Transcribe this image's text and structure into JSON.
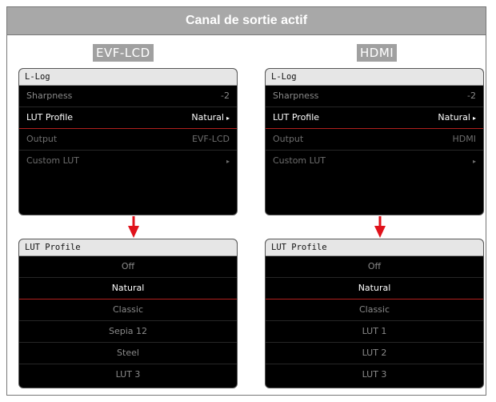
{
  "header": {
    "title": "Canal de sortie actif"
  },
  "columns": [
    {
      "label": "EVF-LCD",
      "menu": {
        "title": "L-Log",
        "rows": [
          {
            "label": "Sharpness",
            "value": "-2",
            "chevron": ""
          },
          {
            "label": "LUT Profile",
            "value": "Natural",
            "chevron": "▸"
          },
          {
            "label": "Output",
            "value": "EVF-LCD",
            "chevron": ""
          },
          {
            "label": "Custom LUT",
            "value": "",
            "chevron": "▸"
          }
        ]
      },
      "lut": {
        "title": "LUT Profile",
        "options": [
          "Off",
          "Natural",
          "Classic",
          "Sepia 12",
          "Steel",
          "LUT 3"
        ],
        "selected": "Natural"
      }
    },
    {
      "label": "HDMI",
      "menu": {
        "title": "L-Log",
        "rows": [
          {
            "label": "Sharpness",
            "value": "-2",
            "chevron": ""
          },
          {
            "label": "LUT Profile",
            "value": "Natural",
            "chevron": "▸"
          },
          {
            "label": "Output",
            "value": "HDMI",
            "chevron": ""
          },
          {
            "label": "Custom LUT",
            "value": "",
            "chevron": "▸"
          }
        ]
      },
      "lut": {
        "title": "LUT Profile",
        "options": [
          "Off",
          "Natural",
          "Classic",
          "LUT 1",
          "LUT 2",
          "LUT 3"
        ],
        "selected": "Natural"
      }
    }
  ],
  "colors": {
    "accent": "#b0201e",
    "arrow": "#e0121b",
    "header_bg": "#a8a8a8"
  },
  "icons": {
    "arrow": "arrow-down-icon",
    "chevron": "chevron-right-icon"
  }
}
